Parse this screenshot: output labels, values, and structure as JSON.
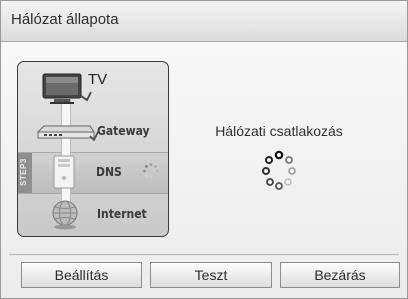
{
  "dialog": {
    "title": "Hálózat állapota"
  },
  "diagram": {
    "step_tag": "STEP3",
    "nodes": [
      {
        "id": "tv",
        "label": "TV",
        "icon": "tv-icon"
      },
      {
        "id": "gateway",
        "label": "Gateway",
        "icon": "gateway-icon"
      },
      {
        "id": "dns",
        "label": "DNS",
        "icon": "dns-server-icon",
        "active": true
      },
      {
        "id": "internet",
        "label": "Internet",
        "icon": "globe-icon"
      }
    ]
  },
  "status": {
    "message": "Hálózati csatlakozás"
  },
  "buttons": {
    "settings": "Beállítás",
    "test": "Teszt",
    "close": "Bezárás"
  },
  "colors": {
    "panel_border": "#3c3c3c",
    "spinner_dark": "#222222",
    "spinner_light": "#bbbbbb"
  }
}
